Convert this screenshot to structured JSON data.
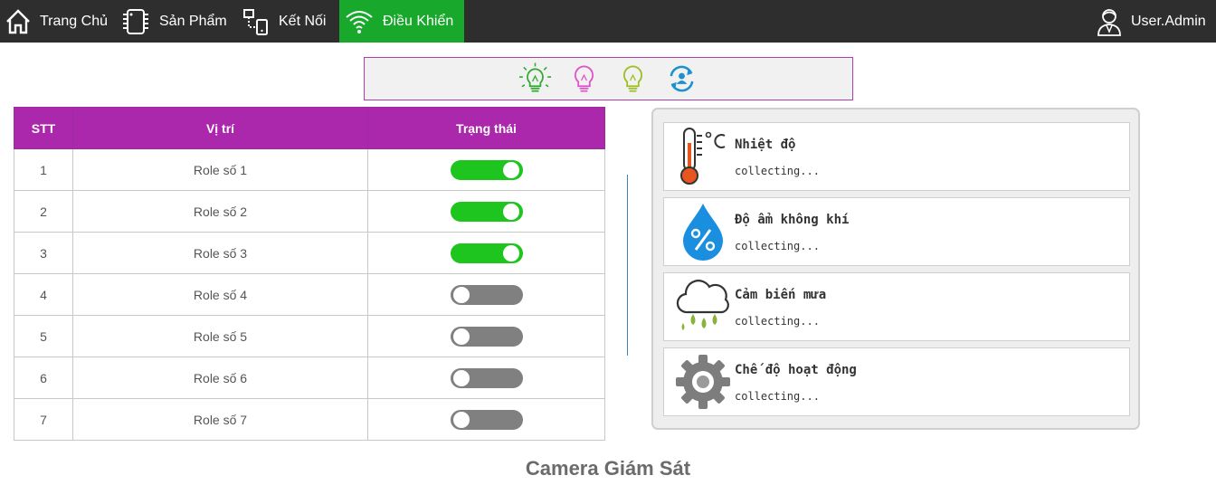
{
  "nav": {
    "home": "Trang Chủ",
    "products": "Sản Phẩm",
    "connect": "Kết Nối",
    "control": "Điều Khiển",
    "user": "User.Admin"
  },
  "toolbar": {
    "icons": [
      "bulb-on-icon",
      "bulb-icon",
      "bulb-icon",
      "refresh-user-icon"
    ],
    "colors": [
      "#2faa2f",
      "#e052c8",
      "#9cc020",
      "#1e8fcf"
    ]
  },
  "table": {
    "headers": {
      "stt": "STT",
      "position": "Vị trí",
      "status": "Trạng thái"
    },
    "rows": [
      {
        "stt": "1",
        "name": "Role số 1",
        "on": true
      },
      {
        "stt": "2",
        "name": "Role số 2",
        "on": true
      },
      {
        "stt": "3",
        "name": "Role số 3",
        "on": true
      },
      {
        "stt": "4",
        "name": "Role số 4",
        "on": false
      },
      {
        "stt": "5",
        "name": "Role số 5",
        "on": false
      },
      {
        "stt": "6",
        "name": "Role số 6",
        "on": false
      },
      {
        "stt": "7",
        "name": "Role số 7",
        "on": false
      }
    ]
  },
  "sensors": [
    {
      "title": "Nhiệt độ",
      "value": "collecting...",
      "icon": "thermometer-icon"
    },
    {
      "title": "Độ ẩm không khí",
      "value": "collecting...",
      "icon": "humidity-drop-icon"
    },
    {
      "title": "Cảm biến mưa",
      "value": "collecting...",
      "icon": "rain-cloud-icon"
    },
    {
      "title": "Chế độ hoạt động",
      "value": "collecting...",
      "icon": "gear-icon"
    }
  ],
  "camera": {
    "title": "Camera Giám Sát"
  },
  "colors": {
    "navbar": "#2e2e2e",
    "nav_active": "#17a82c",
    "table_header": "#ab27ab",
    "toggle_on": "#1ec51e",
    "toggle_off": "#808080"
  }
}
